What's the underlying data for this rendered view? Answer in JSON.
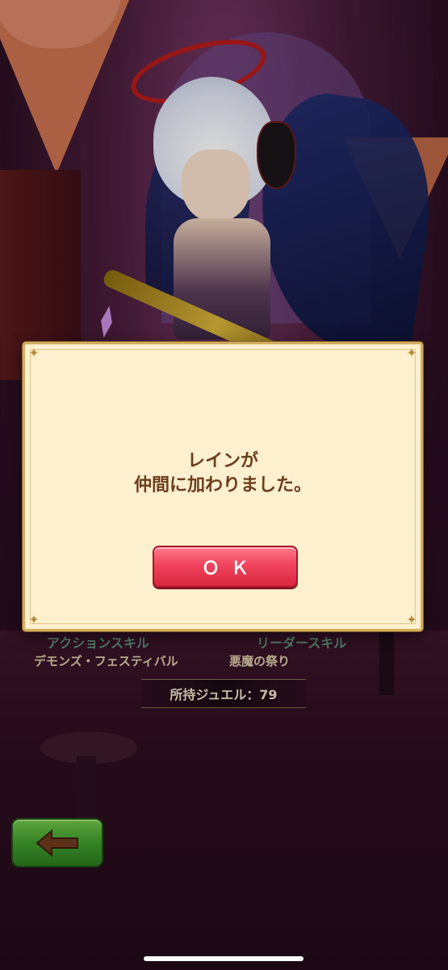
{
  "dialog": {
    "message_line1": "レインが",
    "message_line2": "仲間に加わりました。",
    "ok_label": "ＯＫ"
  },
  "skills": {
    "action_label": "アクションスキル",
    "action_name": "デモンズ・フェスティバル",
    "leader_label": "リーダースキル",
    "leader_name": "悪魔の祭り"
  },
  "jewels": {
    "text": "所持ジュエル：79"
  },
  "icons": {
    "back": "back-arrow-icon"
  },
  "colors": {
    "ok_button": "#f0445e",
    "back_button": "#3f9a2c",
    "dialog_bg": "#fcf0cf",
    "message_text": "#6b3e1e"
  }
}
